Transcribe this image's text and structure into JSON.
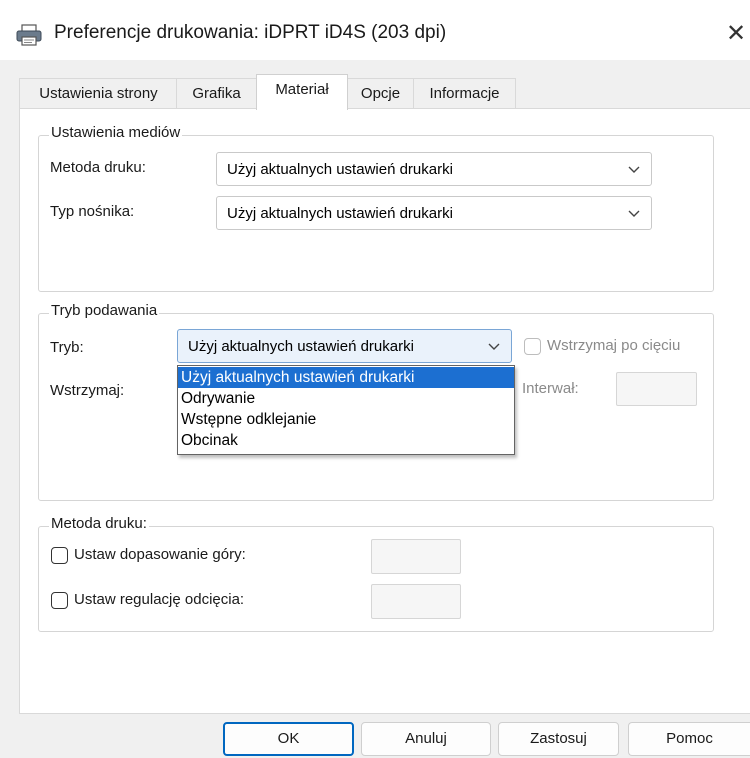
{
  "window": {
    "title": "Preferencje drukowania: iDPRT iD4S (203 dpi)",
    "close_label": "✕"
  },
  "tabs": [
    {
      "label": "Ustawienia strony",
      "selected": false
    },
    {
      "label": "Grafika",
      "selected": false
    },
    {
      "label": "Materiał",
      "selected": true
    },
    {
      "label": "Opcje",
      "selected": false
    },
    {
      "label": "Informacje",
      "selected": false
    }
  ],
  "media_group": {
    "legend": "Ustawienia mediów",
    "print_method_label": "Metoda druku:",
    "print_method_value": "Użyj aktualnych ustawień drukarki",
    "media_type_label": "Typ nośnika:",
    "media_type_value": "Użyj aktualnych ustawień drukarki"
  },
  "feed_group": {
    "legend": "Tryb podawania",
    "mode_label": "Tryb:",
    "mode_value": "Użyj aktualnych ustawień drukarki",
    "pause_after_cut_label": "Wstrzymaj po cięciu",
    "pause_label": "Wstrzymaj:",
    "interval_label": "Interwał:",
    "dropdown_options": [
      "Użyj aktualnych ustawień drukarki",
      "Odrywanie",
      "Wstępne odklejanie",
      "Obcinak"
    ],
    "dropdown_selected_index": 0
  },
  "print_method_group": {
    "legend": "Metoda druku:",
    "top_adjust_label": "Ustaw dopasowanie góry:",
    "cut_adjust_label": "Ustaw regulację odcięcia:"
  },
  "buttons": {
    "ok": "OK",
    "cancel": "Anuluj",
    "apply": "Zastosuj",
    "help": "Pomoc"
  },
  "colors": {
    "selection": "#1c6fd1",
    "default_button_border": "#0067c0"
  }
}
